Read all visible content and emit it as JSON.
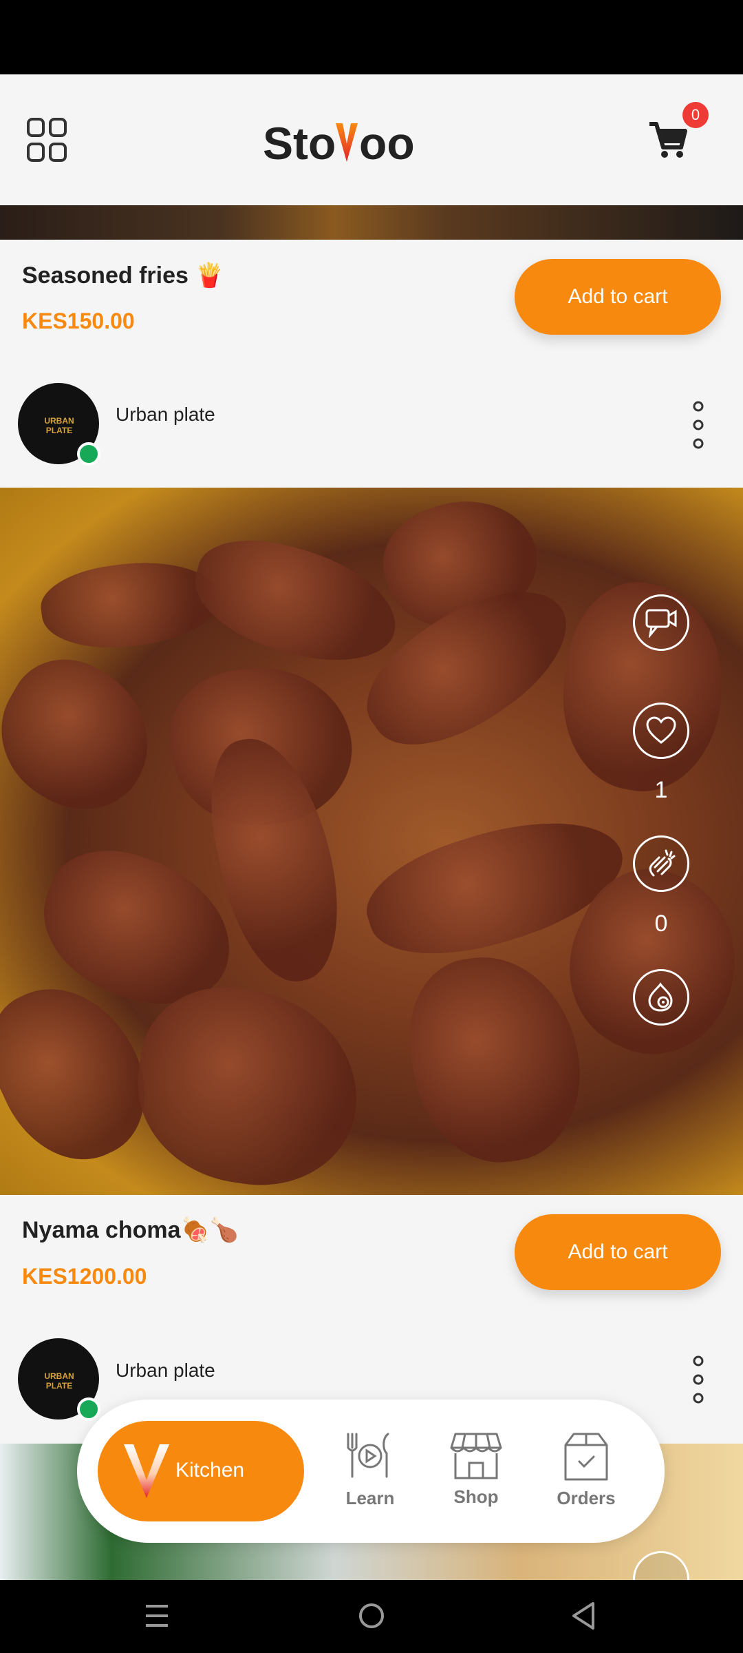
{
  "header": {
    "logo_text": "StoVoo",
    "cart_count": "0"
  },
  "products": [
    {
      "title": "Seasoned fries 🍟",
      "price": "KES150.00",
      "add_label": "Add to cart",
      "seller": "Urban plate",
      "avatar_text": "URBAN PLATE"
    },
    {
      "title": "Nyama choma🍖🍗",
      "price": "KES1200.00",
      "add_label": "Add to cart",
      "seller": "Urban plate",
      "avatar_text": "URBAN PLATE",
      "like_count": "1",
      "clap_count": "0"
    }
  ],
  "nav": {
    "kitchen": "Kitchen",
    "learn": "Learn",
    "shop": "Shop",
    "orders": "Orders"
  },
  "colors": {
    "accent": "#f7890f",
    "badge": "#ee3b35",
    "online": "#17a957"
  }
}
